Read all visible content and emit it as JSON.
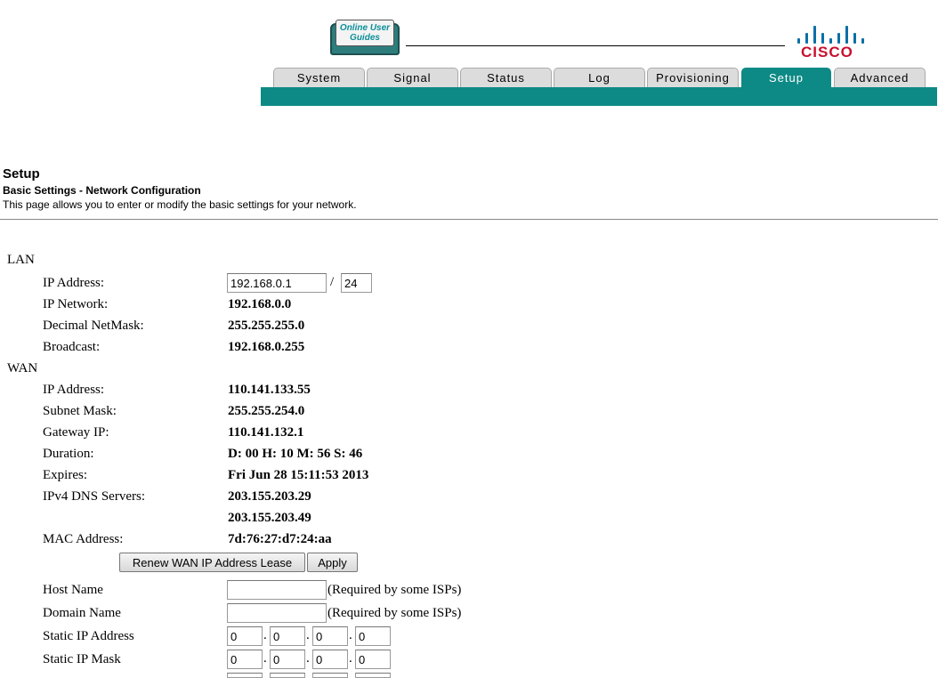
{
  "header": {
    "guides_text": "Online User Guides",
    "brand": "CISCO",
    "tabs": [
      {
        "label": "System",
        "active": false
      },
      {
        "label": "Signal",
        "active": false
      },
      {
        "label": "Status",
        "active": false
      },
      {
        "label": "Log",
        "active": false
      },
      {
        "label": "Provisioning",
        "active": false
      },
      {
        "label": "Setup",
        "active": true
      },
      {
        "label": "Advanced",
        "active": false
      }
    ],
    "accent": "#0e8a86",
    "brand_color": "#c8102e"
  },
  "page": {
    "title": "Setup",
    "subtitle": "Basic Settings - Network Configuration",
    "description": "This page allows you to enter or modify the basic settings for your network."
  },
  "lan": {
    "section": "LAN",
    "ip_address_label": "IP Address:",
    "ip_address_value": "192.168.0.1",
    "prefix_sep": "/",
    "prefix_value": "24",
    "ip_network_label": "IP Network:",
    "ip_network_value": "192.168.0.0",
    "netmask_label": "Decimal NetMask:",
    "netmask_value": "255.255.255.0",
    "broadcast_label": "Broadcast:",
    "broadcast_value": "192.168.0.255"
  },
  "wan": {
    "section": "WAN",
    "ip_address_label": "IP Address:",
    "ip_address_value": "110.141.133.55",
    "subnet_label": "Subnet Mask:",
    "subnet_value": "255.255.254.0",
    "gateway_label": "Gateway IP:",
    "gateway_value": "110.141.132.1",
    "duration_label": "Duration:",
    "duration_value": "D: 00 H: 10 M: 56 S: 46",
    "expires_label": "Expires:",
    "expires_value": "Fri Jun 28 15:11:53 2013",
    "dns_label": "IPv4 DNS Servers:",
    "dns1": "203.155.203.29",
    "dns2": "203.155.203.49",
    "mac_label": "MAC Address:",
    "mac_value": "7d:76:27:d7:24:aa",
    "renew_button": "Renew WAN IP Address Lease",
    "apply_button": "Apply"
  },
  "settings": {
    "host_name_label": "Host Name",
    "host_name_value": "",
    "domain_name_label": "Domain Name",
    "domain_name_value": "",
    "required_note": "(Required by some ISPs)",
    "static_ip_label": "Static IP Address",
    "static_ip": [
      "0",
      "0",
      "0",
      "0"
    ],
    "static_mask_label": "Static IP Mask",
    "static_mask": [
      "0",
      "0",
      "0",
      "0"
    ],
    "dot": "."
  }
}
